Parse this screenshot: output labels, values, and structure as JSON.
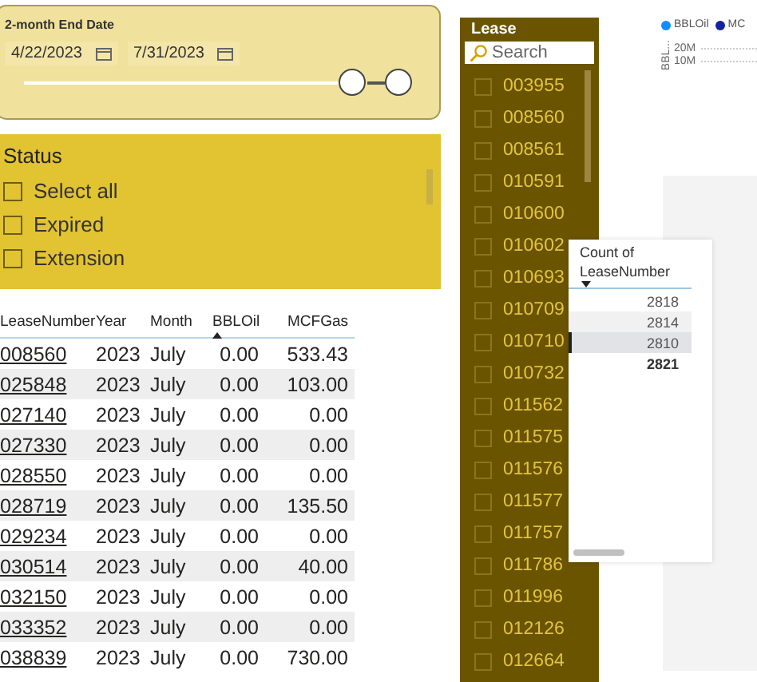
{
  "date_slicer": {
    "title": "2-month End Date",
    "start": "4/22/2023",
    "end": "7/31/2023",
    "thumbs": [
      {
        "level": 0.87
      },
      {
        "level": 1
      }
    ]
  },
  "status_slicer": {
    "title": "Status",
    "items": [
      {
        "label": "Select all",
        "checked": false
      },
      {
        "label": "Expired",
        "checked": false
      },
      {
        "label": "Extension",
        "checked": false
      }
    ]
  },
  "table": {
    "columns": [
      {
        "label": "LeaseNumber",
        "sorted": false
      },
      {
        "label": "Year",
        "sorted": false
      },
      {
        "label": "Month",
        "sorted": false
      },
      {
        "label": "BBLOil",
        "sorted": true
      },
      {
        "label": "MCFGas",
        "sorted": false
      }
    ],
    "rows": [
      [
        "008560",
        "2023",
        "July",
        "0.00",
        "533.43"
      ],
      [
        "025848",
        "2023",
        "July",
        "0.00",
        "103.00"
      ],
      [
        "027140",
        "2023",
        "July",
        "0.00",
        "0.00"
      ],
      [
        "027330",
        "2023",
        "July",
        "0.00",
        "0.00"
      ],
      [
        "028550",
        "2023",
        "July",
        "0.00",
        "0.00"
      ],
      [
        "028719",
        "2023",
        "July",
        "0.00",
        "135.50"
      ],
      [
        "029234",
        "2023",
        "July",
        "0.00",
        "0.00"
      ],
      [
        "030514",
        "2023",
        "July",
        "0.00",
        "40.00"
      ],
      [
        "032150",
        "2023",
        "July",
        "0.00",
        "0.00"
      ],
      [
        "033352",
        "2023",
        "July",
        "0.00",
        "0.00"
      ],
      [
        "038839",
        "2023",
        "July",
        "0.00",
        "730.00"
      ]
    ]
  },
  "lease_slicer": {
    "title": "Lease",
    "placeholder": "Search",
    "items": [
      {
        "label": "003955",
        "checked": false
      },
      {
        "label": "008560",
        "checked": false
      },
      {
        "label": "008561",
        "checked": false
      },
      {
        "label": "010591",
        "checked": false
      },
      {
        "label": "010600",
        "checked": false
      },
      {
        "label": "010602",
        "checked": false
      },
      {
        "label": "010693",
        "checked": false
      },
      {
        "label": "010709",
        "checked": false
      },
      {
        "label": "010710",
        "checked": false
      },
      {
        "label": "010732",
        "checked": false
      },
      {
        "label": "011562",
        "checked": false
      },
      {
        "label": "011575",
        "checked": false
      },
      {
        "label": "011576",
        "checked": false
      },
      {
        "label": "011577",
        "checked": false
      },
      {
        "label": "011757",
        "checked": false
      },
      {
        "label": "011786",
        "checked": false
      },
      {
        "label": "011996",
        "checked": false
      },
      {
        "label": "012126",
        "checked": false
      },
      {
        "label": "012664",
        "checked": false
      }
    ]
  },
  "chart": {
    "legend": [
      {
        "label": "BBLOil",
        "color": "#118dff"
      },
      {
        "label": "MC",
        "color": "#12239e"
      }
    ],
    "axis_label": "BBL...",
    "ticks": [
      "20M",
      "10M"
    ]
  },
  "count_table": {
    "header": "Count of LeaseNumber",
    "rows": [
      {
        "value": "2818",
        "selected": false
      },
      {
        "value": "2814",
        "selected": false
      },
      {
        "value": "2810",
        "selected": true
      }
    ],
    "total": "2821"
  }
}
